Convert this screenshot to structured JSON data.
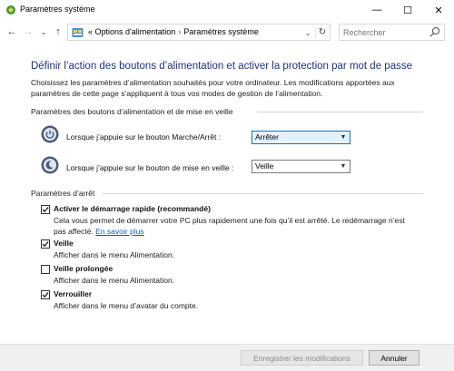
{
  "window": {
    "title": "Paramètres système",
    "minimize_glyph": "—",
    "maximize_glyph": "☐",
    "close_glyph": "✕"
  },
  "nav": {
    "back_glyph": "←",
    "forward_glyph": "→",
    "recent_glyph": "⌄",
    "up_glyph": "↑"
  },
  "address": {
    "prefix": "«",
    "crumbs": [
      "Options d'alimentation",
      "Paramètres système"
    ],
    "separator": "›",
    "dropdown_glyph": "⌄",
    "refresh_glyph": "↻"
  },
  "search": {
    "placeholder": "Rechercher"
  },
  "main": {
    "title": "Définir l’action des boutons d’alimentation et activer la protection par mot de passe",
    "intro": "Choisissez les paramètres d’alimentation souhaités pour votre ordinateur. Les modifications apportées aux paramètres de cette page s’appliquent à tous vos modes de gestion de l’alimentation."
  },
  "power_buttons": {
    "heading": "Paramètres des boutons d’alimentation et de mise en veille",
    "rows": [
      {
        "label": "Lorsque j’appuie sur le bouton Marche/Arrêt :",
        "value": "Arrêter"
      },
      {
        "label": "Lorsque j’appuie sur le bouton de mise en veille :",
        "value": "Veille"
      }
    ]
  },
  "shutdown": {
    "heading": "Paramètres d’arrêt",
    "options": [
      {
        "title": "Activer le démarrage rapide (recommandé)",
        "desc": "Cela vous permet de démarrer votre PC plus rapidement une fois qu’il est arrêté. Le redémarrage n’est pas affecté.",
        "link": "En savoir plus",
        "checked": true
      },
      {
        "title": "Veille",
        "desc": "Afficher dans le menu Alimentation.",
        "checked": true
      },
      {
        "title": "Veille prolongée",
        "desc": "Afficher dans le menu Alimentation.",
        "checked": false
      },
      {
        "title": "Verrouiller",
        "desc": "Afficher dans le menu d’avatar du compte.",
        "checked": true
      }
    ]
  },
  "footer": {
    "save_label": "Enregistrer les modifications",
    "cancel_label": "Annuler"
  },
  "colors": {
    "title_blue": "#1e3287",
    "link_blue": "#0066cc",
    "footer_bg": "#f0f0f0"
  }
}
